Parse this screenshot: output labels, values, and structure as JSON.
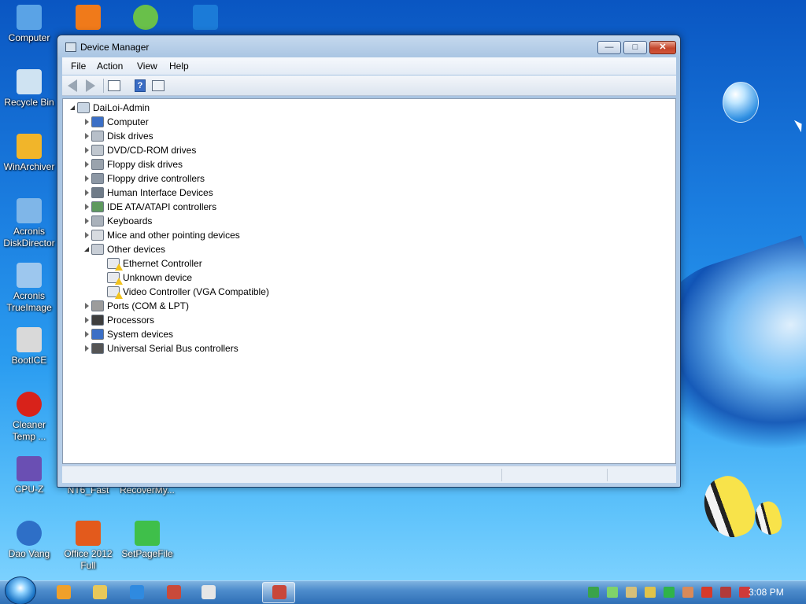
{
  "desktop": {
    "icons": [
      {
        "label": "Computer",
        "icon": "computer-icon",
        "color": "#5aa3e6"
      },
      {
        "label": "Recycle Bin",
        "icon": "recycle-bin-icon",
        "color": "#cfe3f2"
      },
      {
        "label": "WinArchiver",
        "icon": "winarchiver-icon",
        "color": "#f1b52a"
      },
      {
        "label": "Acronis DiskDirector",
        "icon": "acronis-diskdirector-icon",
        "color": "#7fb6e8"
      },
      {
        "label": "Acronis TrueImage",
        "icon": "acronis-trueimage-icon",
        "color": "#9dc7ee"
      },
      {
        "label": "BootICE",
        "icon": "bootice-icon",
        "color": "#d9d9d9"
      },
      {
        "label": "Cleaner Temp ...",
        "icon": "cleaner-icon",
        "color": "#d8221a"
      },
      {
        "label": "CPU-Z",
        "icon": "cpuz-icon",
        "color": "#6a4fb3"
      },
      {
        "label": "NT6_Fast",
        "icon": "nt6-fast-icon",
        "color": "#4a90d9"
      },
      {
        "label": "RecoverMy...",
        "icon": "recovermy-icon",
        "color": "#4a90d9"
      },
      {
        "label": "Dao Vang",
        "icon": "dao-vang-icon",
        "color": "#2e6fc7"
      },
      {
        "label": "Office 2012 Full",
        "icon": "office-icon",
        "color": "#e35a1c"
      },
      {
        "label": "SetPageFile",
        "icon": "setpagefile-icon",
        "color": "#3fbf4a"
      }
    ],
    "top_icons": [
      {
        "icon": "office-folder-icon",
        "color": "#f07a1a"
      },
      {
        "icon": "utorrent-icon",
        "color": "#69c04a"
      },
      {
        "icon": "teamviewer-icon",
        "color": "#1b7bd8"
      }
    ]
  },
  "window": {
    "title": "Device Manager",
    "menu": [
      "File",
      "Action",
      "View",
      "Help"
    ],
    "toolbar": {
      "help_glyph": "?"
    },
    "tree": [
      {
        "label": "DaiLoi-Admin",
        "level": 0,
        "state": "expanded",
        "icon": "computer-root-icon"
      },
      {
        "label": "Computer",
        "level": 1,
        "state": "collapsed",
        "icon": "monitor-icon"
      },
      {
        "label": "Disk drives",
        "level": 1,
        "state": "collapsed",
        "icon": "disk-drive-icon"
      },
      {
        "label": "DVD/CD-ROM drives",
        "level": 1,
        "state": "collapsed",
        "icon": "dvd-drive-icon"
      },
      {
        "label": "Floppy disk drives",
        "level": 1,
        "state": "collapsed",
        "icon": "floppy-drive-icon"
      },
      {
        "label": "Floppy drive controllers",
        "level": 1,
        "state": "collapsed",
        "icon": "floppy-controller-icon"
      },
      {
        "label": "Human Interface Devices",
        "level": 1,
        "state": "collapsed",
        "icon": "hid-icon"
      },
      {
        "label": "IDE ATA/ATAPI controllers",
        "level": 1,
        "state": "collapsed",
        "icon": "ide-controller-icon"
      },
      {
        "label": "Keyboards",
        "level": 1,
        "state": "collapsed",
        "icon": "keyboard-icon"
      },
      {
        "label": "Mice and other pointing devices",
        "level": 1,
        "state": "collapsed",
        "icon": "mouse-icon"
      },
      {
        "label": "Other devices",
        "level": 1,
        "state": "expanded",
        "icon": "other-devices-icon"
      },
      {
        "label": "Ethernet Controller",
        "level": 2,
        "state": "leaf",
        "icon": "warning-device-icon"
      },
      {
        "label": "Unknown device",
        "level": 2,
        "state": "leaf",
        "icon": "warning-device-icon"
      },
      {
        "label": "Video Controller (VGA Compatible)",
        "level": 2,
        "state": "leaf",
        "icon": "warning-device-icon"
      },
      {
        "label": "Ports (COM & LPT)",
        "level": 1,
        "state": "collapsed",
        "icon": "port-icon"
      },
      {
        "label": "Processors",
        "level": 1,
        "state": "collapsed",
        "icon": "processor-icon"
      },
      {
        "label": "System devices",
        "level": 1,
        "state": "collapsed",
        "icon": "system-devices-icon"
      },
      {
        "label": "Universal Serial Bus controllers",
        "level": 1,
        "state": "collapsed",
        "icon": "usb-icon"
      }
    ]
  },
  "taskbar": {
    "pinned": [
      {
        "icon": "media-player-icon",
        "color": "#f0a02a"
      },
      {
        "icon": "explorer-folder-icon",
        "color": "#e8c85a"
      },
      {
        "icon": "internet-explorer-icon",
        "color": "#2f8ae0"
      },
      {
        "icon": "network-tool-icon",
        "color": "#c94a3a"
      },
      {
        "icon": "paint-icon",
        "color": "#e6e6e6"
      },
      {
        "icon": "device-manager-task-icon",
        "color": "#c8473a"
      }
    ],
    "tray": [
      {
        "icon": "network-globe-icon",
        "color": "#3aa34a"
      },
      {
        "icon": "security-check-icon",
        "color": "#7fd36a"
      },
      {
        "icon": "printer-icon",
        "color": "#d6c07a"
      },
      {
        "icon": "pencil-tool-icon",
        "color": "#e0c34a"
      },
      {
        "icon": "play-icon",
        "color": "#2fb34a"
      },
      {
        "icon": "remote-icon",
        "color": "#d98a5a"
      },
      {
        "icon": "alert-icon",
        "color": "#d63a2a"
      },
      {
        "icon": "display-icon",
        "color": "#b23a3a"
      },
      {
        "icon": "volume-muted-icon",
        "color": "#cf3a3a"
      }
    ],
    "clock": "3:08 PM"
  }
}
